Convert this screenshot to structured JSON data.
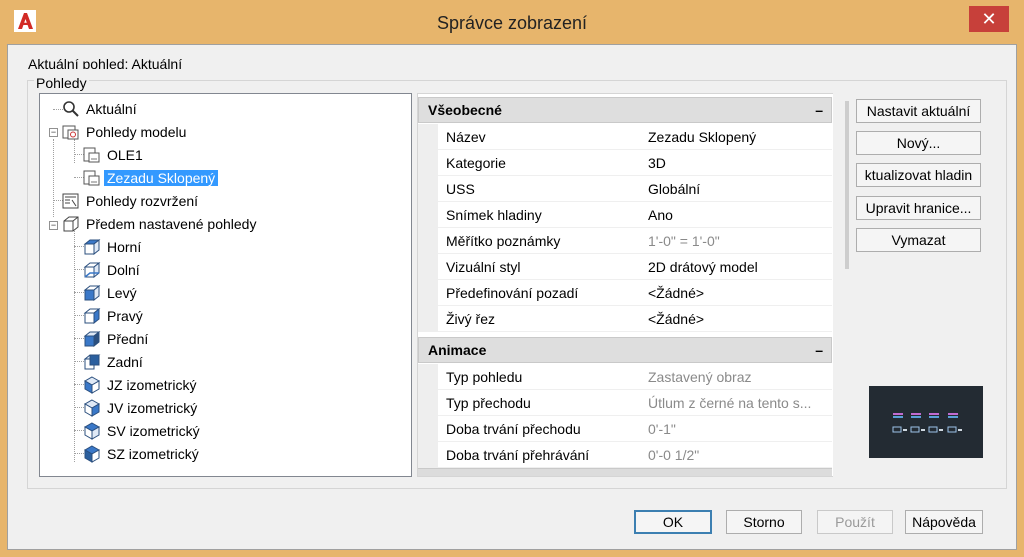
{
  "window": {
    "title": "Správce zobrazení",
    "close_label": "✕"
  },
  "current_view": "Aktuální pohled: Aktuální",
  "views_group_label": "Pohledy",
  "tree": [
    {
      "label": "Aktuální",
      "icon": "magnifier-icon"
    },
    {
      "label": "Pohledy modelu",
      "icon": "model-views-icon"
    },
    {
      "label": "OLE1",
      "icon": "named-view-icon"
    },
    {
      "label": "Zezadu Sklopený",
      "icon": "named-view-icon"
    },
    {
      "label": "Pohledy rozvržení",
      "icon": "layout-views-icon"
    },
    {
      "label": "Předem nastavené pohledy",
      "icon": "preset-views-icon"
    },
    {
      "label": "Horní",
      "icon": "top-view-icon"
    },
    {
      "label": "Dolní",
      "icon": "bottom-view-icon"
    },
    {
      "label": "Levý",
      "icon": "left-view-icon"
    },
    {
      "label": "Pravý",
      "icon": "right-view-icon"
    },
    {
      "label": "Přední",
      "icon": "front-view-icon"
    },
    {
      "label": "Zadní",
      "icon": "back-view-icon"
    },
    {
      "label": "JZ izometrický",
      "icon": "sw-iso-view-icon"
    },
    {
      "label": "JV izometrický",
      "icon": "se-iso-view-icon"
    },
    {
      "label": "SV izometrický",
      "icon": "ne-iso-view-icon"
    },
    {
      "label": "SZ izometrický",
      "icon": "nw-iso-view-icon"
    }
  ],
  "props": {
    "general": {
      "label": "Všeobecné",
      "collapse": "–",
      "rows": [
        {
          "name": "Název",
          "value": "Zezadu Sklopený"
        },
        {
          "name": "Kategorie",
          "value": "3D"
        },
        {
          "name": "USS",
          "value": "Globální"
        },
        {
          "name": "Snímek hladiny",
          "value": "Ano"
        },
        {
          "name": "Měřítko poznámky",
          "value": "1'-0\" = 1'-0\""
        },
        {
          "name": "Vizuální styl",
          "value": "2D drátový model"
        },
        {
          "name": "Předefinování pozadí",
          "value": "<Žádné>"
        },
        {
          "name": "Živý řez",
          "value": "<Žádné>"
        }
      ]
    },
    "animation": {
      "label": "Animace",
      "collapse": "–",
      "rows": [
        {
          "name": "Typ pohledu",
          "value": "Zastavený obraz"
        },
        {
          "name": "Typ přechodu",
          "value": "Útlum z černé na tento s..."
        },
        {
          "name": "Doba trvání přechodu",
          "value": "0'-1\""
        },
        {
          "name": "Doba trvání přehrávání",
          "value": "0'-0 1/2\""
        }
      ]
    }
  },
  "side_buttons": {
    "set_current": "Nastavit aktuální",
    "new": "Nový...",
    "update_layers": "ktualizovat hladin",
    "edit_boundaries": "Upravit hranice...",
    "delete": "Vymazat"
  },
  "bottom_buttons": {
    "ok": "OK",
    "cancel": "Storno",
    "apply": "Použít",
    "help": "Nápověda"
  },
  "colors": {
    "title_bar": "#e7b56c",
    "close_button": "#c7403a",
    "selection": "#3399ff",
    "preview_bg": "#232b33"
  }
}
